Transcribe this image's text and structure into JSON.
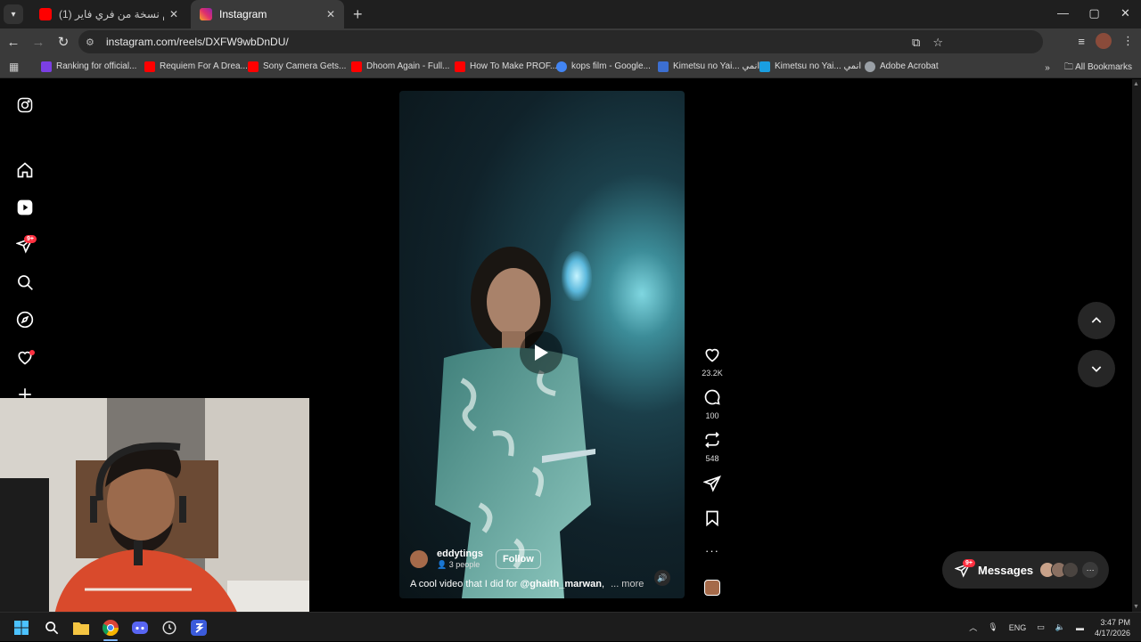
{
  "browser": {
    "tabs": [
      {
        "label": "(1) حملت اقدم نسخة من فري فاير",
        "close": "✕",
        "favicon_color": "#ff0000"
      },
      {
        "label": "Instagram",
        "close": "✕",
        "favicon_color": "#e1306c"
      }
    ],
    "new_tab": "+",
    "window_controls": {
      "minimize": "—",
      "maximize": "▢",
      "close": "✕"
    },
    "url": "instagram.com/reels/DXFW9wbDnDU/",
    "bookmarks": [
      {
        "label": "Ranking for official...",
        "favicon_color": "#7b3fe4"
      },
      {
        "label": "Requiem For A Drea...",
        "favicon_color": "#ff0000"
      },
      {
        "label": "Sony Camera Gets...",
        "favicon_color": "#ff0000"
      },
      {
        "label": "Dhoom Again - Full...",
        "favicon_color": "#ff0000"
      },
      {
        "label": "How To Make PROF...",
        "favicon_color": "#ff0000"
      },
      {
        "label": "kops film - Google...",
        "favicon_color": "#4285f4"
      },
      {
        "label": "Kimetsu no Yai... انمي",
        "favicon_color": "#3c6fd1"
      },
      {
        "label": "Kimetsu no Yai... انمي",
        "favicon_color": "#1a9ee0"
      },
      {
        "label": "Adobe Acrobat",
        "favicon_color": "#9aa0a6"
      }
    ],
    "bookmarks_overflow": "»",
    "all_bookmarks": "All Bookmarks"
  },
  "sidebar": {
    "notifications_badge": "9+"
  },
  "reel": {
    "author": "eddytings",
    "people": "3 people",
    "follow_label": "Follow",
    "caption_text": "A cool video that I did for ",
    "caption_mention": "@ghaith_marwan",
    "caption_suffix": ",",
    "more_label": "... more"
  },
  "actions": {
    "likes": "23.2K",
    "comments": "100",
    "reposts": "548",
    "more": "···"
  },
  "messages": {
    "label": "Messages",
    "badge": "9+",
    "more": "···"
  },
  "taskbar": {
    "language": "ENG",
    "time": "3:47 PM",
    "date": "4/17/2026"
  }
}
